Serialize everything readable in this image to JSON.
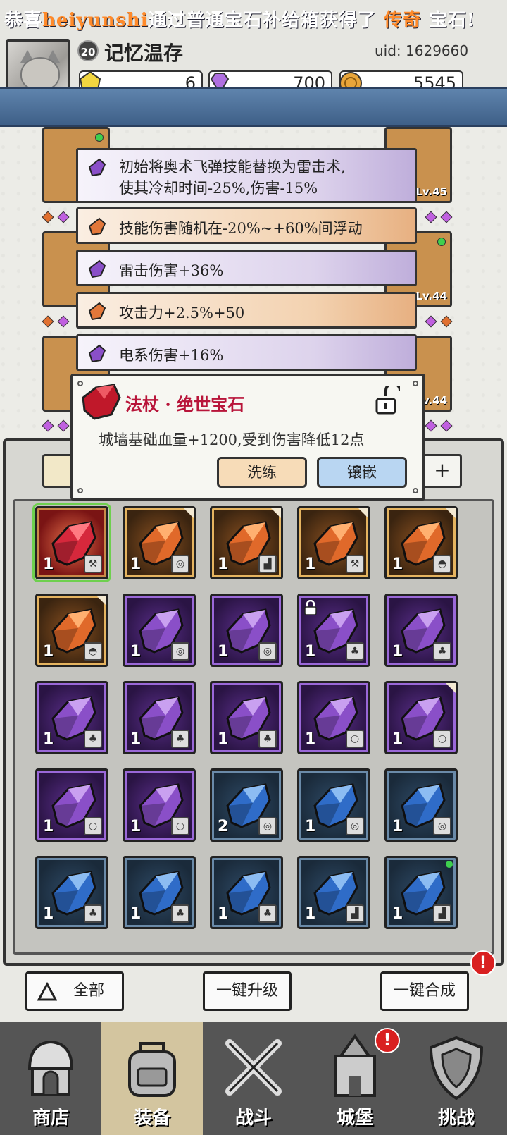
{
  "player": {
    "level": "20",
    "name": "记忆温存",
    "uid": "uid: 1629660"
  },
  "currencies": [
    {
      "icon": "gold-gem-icon",
      "value": "6"
    },
    {
      "icon": "purple-diamond-icon",
      "value": "700"
    },
    {
      "icon": "coin-icon",
      "value": "5545"
    }
  ],
  "announcement": {
    "prefix": "恭喜",
    "user": "heiyunshi",
    "middle": "通过普通宝石补给箱获得了",
    "rarity": "传奇",
    "suffix": "宝石!"
  },
  "equipment_levels": {
    "right_1": "Lv.45",
    "right_2": "Lv.44",
    "right_3": "Lv.44"
  },
  "gem_attributes": [
    {
      "tier": "purple",
      "line1": "初始将奥术飞弹技能替换为雷击术,",
      "line2": "使其冷却时间-25%,伤害-15%"
    },
    {
      "tier": "orange",
      "line1": "技能伤害随机在-20%~+60%间浮动"
    },
    {
      "tier": "purple",
      "line1": "雷击伤害+36%"
    },
    {
      "tier": "orange",
      "line1": "攻击力+2.5%+50"
    },
    {
      "tier": "purple",
      "line1": "电系伤害+16%"
    }
  ],
  "popup": {
    "title": "法杖 · 绝世宝石",
    "description": "城墙基础血量+1200,受到伤害降低12点",
    "refine_label": "洗练",
    "inlay_label": "镶嵌"
  },
  "inventory": [
    {
      "tier": "red",
      "qty": "1",
      "type": "staff",
      "selected": true
    },
    {
      "tier": "orange",
      "qty": "1",
      "type": "ring",
      "flag": true
    },
    {
      "tier": "orange",
      "qty": "1",
      "type": "boot",
      "flag": true
    },
    {
      "tier": "orange",
      "qty": "1",
      "type": "staff",
      "flag": true
    },
    {
      "tier": "orange",
      "qty": "1",
      "type": "helm",
      "flag": true
    },
    {
      "tier": "orange",
      "qty": "1",
      "type": "helm",
      "flag": true
    },
    {
      "tier": "purple",
      "qty": "1",
      "type": "ring"
    },
    {
      "tier": "purple",
      "qty": "1",
      "type": "ring"
    },
    {
      "tier": "purple",
      "qty": "1",
      "type": "armor",
      "locked": true
    },
    {
      "tier": "purple",
      "qty": "1",
      "type": "armor"
    },
    {
      "tier": "purple",
      "qty": "1",
      "type": "armor"
    },
    {
      "tier": "purple",
      "qty": "1",
      "type": "armor"
    },
    {
      "tier": "purple",
      "qty": "1",
      "type": "armor"
    },
    {
      "tier": "purple",
      "qty": "1",
      "type": "necklace"
    },
    {
      "tier": "purple",
      "qty": "1",
      "type": "necklace",
      "flag": true
    },
    {
      "tier": "purple",
      "qty": "1",
      "type": "necklace"
    },
    {
      "tier": "purple",
      "qty": "1",
      "type": "necklace"
    },
    {
      "tier": "blue",
      "qty": "2",
      "type": "ring"
    },
    {
      "tier": "blue",
      "qty": "1",
      "type": "ring"
    },
    {
      "tier": "blue",
      "qty": "1",
      "type": "ring"
    },
    {
      "tier": "blue",
      "qty": "1",
      "type": "armor"
    },
    {
      "tier": "blue",
      "qty": "1",
      "type": "armor"
    },
    {
      "tier": "blue",
      "qty": "1",
      "type": "armor"
    },
    {
      "tier": "blue",
      "qty": "1",
      "type": "boot"
    },
    {
      "tier": "blue",
      "qty": "1",
      "type": "boot",
      "dot": true
    }
  ],
  "actions": {
    "filter_all": "全部",
    "upgrade_all": "一键升级",
    "merge_all": "一键合成"
  },
  "nav": [
    {
      "label": "商店",
      "icon": "shop-icon",
      "active": false
    },
    {
      "label": "装备",
      "icon": "backpack-icon",
      "active": true
    },
    {
      "label": "战斗",
      "icon": "crossed-swords-icon",
      "active": false
    },
    {
      "label": "城堡",
      "icon": "castle-icon",
      "active": false,
      "alert": true
    },
    {
      "label": "挑战",
      "icon": "shield-icon",
      "active": false
    }
  ],
  "alert_glyph": "!"
}
